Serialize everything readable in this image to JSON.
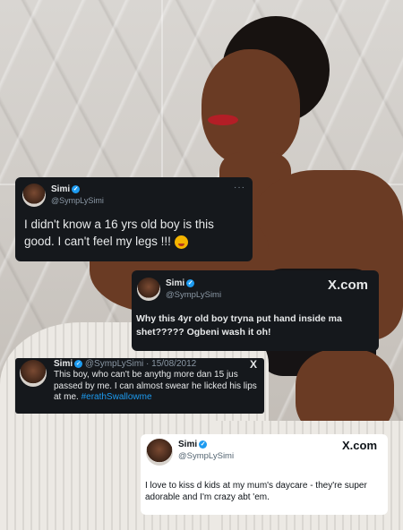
{
  "tweets": [
    {
      "name": "Simi",
      "handle": "@SympLySimi",
      "text": "I didn't know a 16 yrs old boy is this good. I can't feel my legs !!!",
      "more": "···",
      "emoji": "blushing-face-emoji"
    },
    {
      "name": "Simi",
      "handle": "@SympLySimi",
      "text": "Why this 4yr old boy tryna put hand inside ma shet????? Ogbeni wash it oh!",
      "brand": "X.com"
    },
    {
      "name": "Simi",
      "handle": "@SympLySimi",
      "date": "· 15/08/2012",
      "text": "This boy, who can't be anythg more dan 15 jus passed by me. I can almost swear he licked his lips at me.",
      "hashtag": "#erathSwallowme",
      "brand": "X"
    },
    {
      "name": "Simi",
      "handle": "@SympLySimi",
      "text": "I love to kiss d kids at my mum's daycare - they're super adorable and I'm crazy abt 'em.",
      "brand": "X.com"
    }
  ],
  "colors": {
    "dark_card": "#15181c",
    "light_card": "#ffffff",
    "verified": "#1d9bf0",
    "hashtag": "#1d9bf0"
  }
}
